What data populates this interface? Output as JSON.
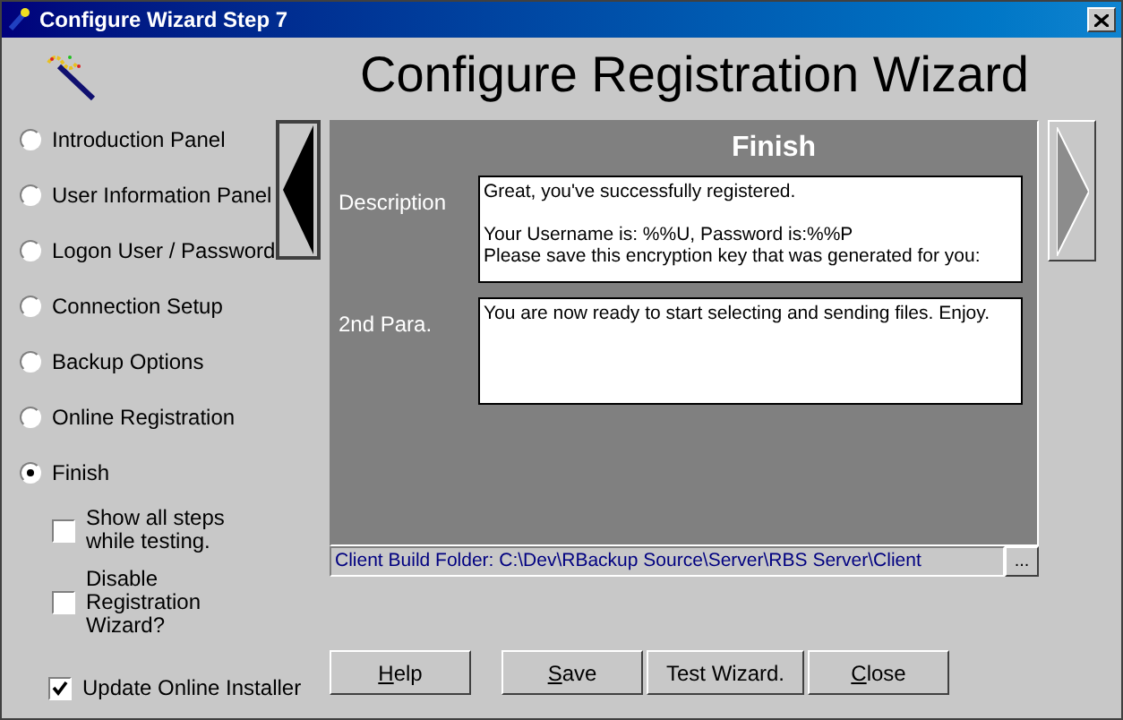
{
  "window": {
    "title": "Configure Wizard Step 7"
  },
  "heading": "Configure Registration Wizard",
  "steps": [
    {
      "label": "Introduction Panel",
      "selected": false
    },
    {
      "label": "User Information Panel",
      "selected": false
    },
    {
      "label": "Logon User / Password",
      "selected": false
    },
    {
      "label": "Connection Setup",
      "selected": false
    },
    {
      "label": "Backup Options",
      "selected": false
    },
    {
      "label": "Online Registration",
      "selected": false
    },
    {
      "label": "Finish",
      "selected": true
    }
  ],
  "options": [
    {
      "label": "Show all steps while testing.",
      "checked": false
    },
    {
      "label": "Disable Registration Wizard?",
      "checked": false
    }
  ],
  "update_installer": {
    "label": "Update Online Installer",
    "checked": true
  },
  "panel": {
    "title": "Finish",
    "fields": [
      {
        "label": "Description",
        "value": "Great, you've successfully registered.\n\nYour Username is: %%U, Password is:%%P\nPlease save this encryption key that was generated for you:"
      },
      {
        "label": "2nd Para.",
        "value": "You are now ready to start selecting and sending files. Enjoy."
      }
    ]
  },
  "build_folder": {
    "text": "Client Build Folder: C:\\Dev\\RBackup Source\\Server\\RBS Server\\Client",
    "browse": "..."
  },
  "buttons": [
    {
      "label": "Help",
      "mnemonic": true
    },
    {
      "label": "Save",
      "mnemonic": true
    },
    {
      "label": "Test Wizard.",
      "mnemonic": false
    },
    {
      "label": "Close",
      "mnemonic": true
    }
  ]
}
